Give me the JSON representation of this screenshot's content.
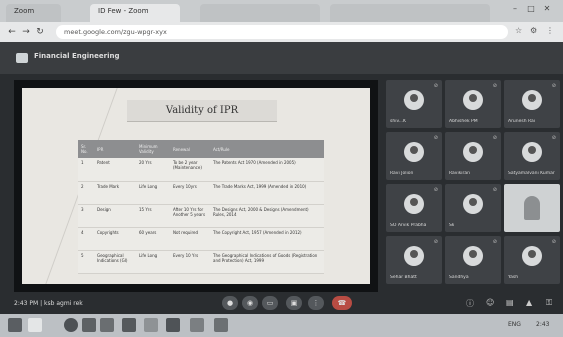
{
  "browser": {
    "tabs": [
      "Zoom",
      "ID Few - Zoom"
    ],
    "url": "meet.google.com/zgu-wpgr-xyx",
    "nav_icons": [
      "back-icon",
      "forward-icon",
      "reload-icon"
    ]
  },
  "meeting": {
    "title": "Financial Engineering",
    "time_label": "2:43 PM | ksb agmi rek"
  },
  "slide": {
    "title": "Validity of IPR",
    "table": {
      "headers": [
        "Sr. No.",
        "IPR",
        "Minimum Validity",
        "Renewal",
        "Act/Rule"
      ],
      "rows": [
        [
          "1",
          "Patent",
          "20 Yrs",
          "To be 2 year (Maintenance)",
          "The Patents Act 1970 (Amended in 2005)"
        ],
        [
          "2",
          "Trade Mark",
          "Life Long",
          "Every 10yrs",
          "The Trade Marks Act, 1999 (Amended in 2010)"
        ],
        [
          "3",
          "Design",
          "15 Yrs",
          "After 10 Yrs for Another 5 years",
          "The Designs Act, 2000 & Designs (Amendment) Rules, 2014"
        ],
        [
          "4",
          "Copyrights",
          "60 years",
          "Not required",
          "The Copyright Act, 1957 (Amended in 2012)"
        ],
        [
          "5",
          "Geographical Indications (GI)",
          "Life Long",
          "Every 10 Yrs",
          "The Geographical Indications of Goods (Registration and Protection) Act, 1999"
        ]
      ]
    }
  },
  "participants": [
    {
      "name": "shiv...K",
      "type": "avatar"
    },
    {
      "name": "Abhishek PM",
      "type": "avatar"
    },
    {
      "name": "Arunesh Rai",
      "type": "avatar"
    },
    {
      "name": "Ravi Jolion",
      "type": "avatar"
    },
    {
      "name": "Ravikiran",
      "type": "avatar"
    },
    {
      "name": "Satyamalvani Kumar",
      "type": "avatar"
    },
    {
      "name": "SO Arvik Prabha",
      "type": "avatar"
    },
    {
      "name": "Sk",
      "type": "avatar"
    },
    {
      "name": "",
      "type": "video"
    },
    {
      "name": "Sehar Bhatt",
      "type": "avatar"
    },
    {
      "name": "Sandhya",
      "type": "avatar"
    },
    {
      "name": "Yash",
      "type": "avatar"
    }
  ],
  "controls": [
    "mic-icon",
    "camera-icon",
    "captions-icon",
    "present-icon",
    "more-icon",
    "leave-call-icon"
  ],
  "right_controls": [
    "info-icon",
    "people-icon",
    "chat-icon",
    "activities-icon",
    "lock-icon"
  ],
  "taskbar": {
    "clock": "2:43",
    "lang": "ENG"
  },
  "colors": {
    "leave": "#b84c43",
    "table_header": "#8d8e90"
  }
}
